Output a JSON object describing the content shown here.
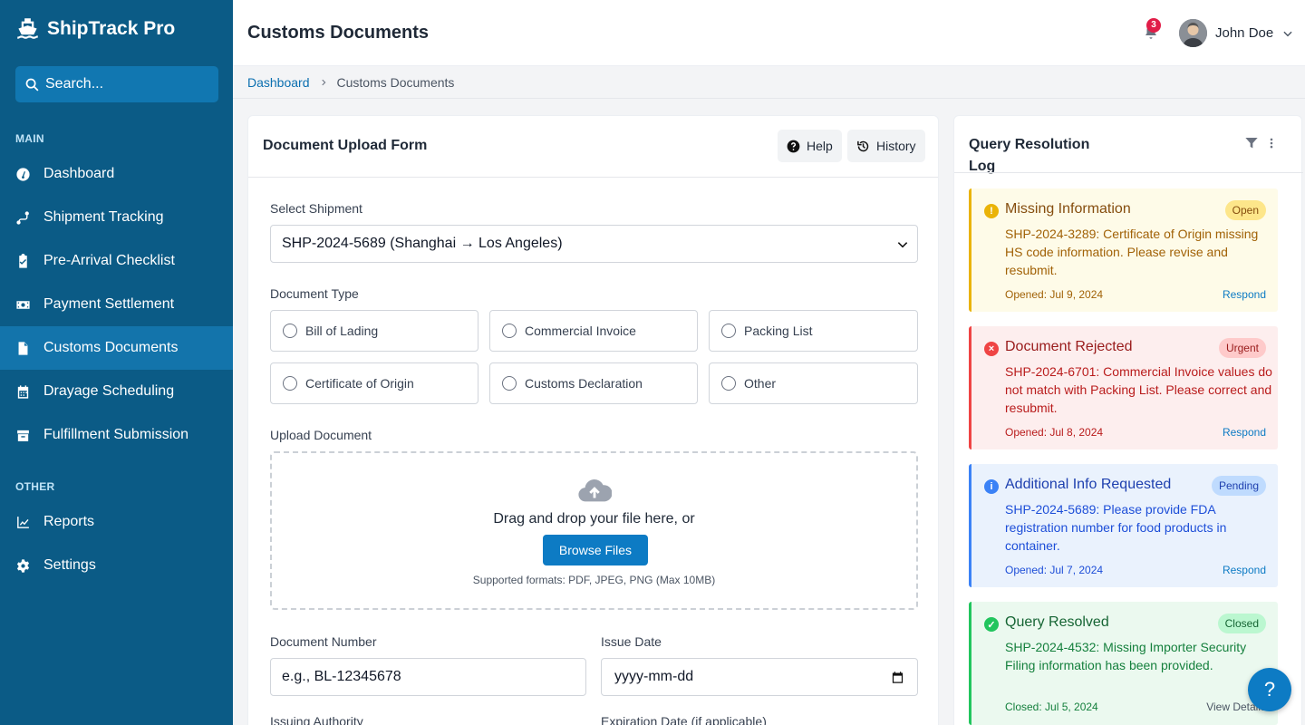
{
  "app": {
    "name": "ShipTrack Pro"
  },
  "search": {
    "placeholder": "Search..."
  },
  "sidebar": {
    "main_label": "MAIN",
    "other_label": "OTHER",
    "items": [
      {
        "label": "Dashboard",
        "icon": "gauge-icon"
      },
      {
        "label": "Shipment Tracking",
        "icon": "route-icon"
      },
      {
        "label": "Pre-Arrival Checklist",
        "icon": "clipboard-check-icon"
      },
      {
        "label": "Payment Settlement",
        "icon": "money-icon"
      },
      {
        "label": "Customs Documents",
        "icon": "file-icon",
        "active": true
      },
      {
        "label": "Drayage Scheduling",
        "icon": "calendar-icon"
      },
      {
        "label": "Fulfillment Submission",
        "icon": "box-icon"
      }
    ],
    "other_items": [
      {
        "label": "Reports",
        "icon": "chart-line-icon"
      },
      {
        "label": "Settings",
        "icon": "gear-icon"
      }
    ]
  },
  "header": {
    "title": "Customs Documents",
    "notifications": "3",
    "user_name": "John Doe"
  },
  "breadcrumb": {
    "home": "Dashboard",
    "current": "Customs Documents"
  },
  "form": {
    "title": "Document Upload Form",
    "help_label": "Help",
    "history_label": "History",
    "shipment_label": "Select Shipment",
    "shipment_value": "SHP-2024-5689 (Shanghai → Los Angeles)",
    "doc_type_label": "Document Type",
    "doc_types": [
      "Bill of Lading",
      "Commercial Invoice",
      "Packing List",
      "Certificate of Origin",
      "Customs Declaration",
      "Other"
    ],
    "upload_label": "Upload Document",
    "drop_text": "Drag and drop your file here, or",
    "browse_label": "Browse Files",
    "formats_text": "Supported formats: PDF, JPEG, PNG (Max 10MB)",
    "doc_number_label": "Document Number",
    "doc_number_placeholder": "e.g., BL-12345678",
    "issue_date_label": "Issue Date",
    "issue_date_placeholder": "yyyy-mm-dd",
    "issuing_authority_label": "Issuing Authority",
    "expiration_label": "Expiration Date (if applicable)"
  },
  "query_log": {
    "title": "Query Resolution Log",
    "items": [
      {
        "title": "Missing Information",
        "badge": "Open",
        "text": "SHP-2024-3289: Certificate of Origin missing HS code information. Please revise and resubmit.",
        "date": "Opened: Jul 9, 2024",
        "action": "Respond"
      },
      {
        "title": "Document Rejected",
        "badge": "Urgent",
        "text": "SHP-2024-6701: Commercial Invoice values do not match with Packing List. Please correct and resubmit.",
        "date": "Opened: Jul 8, 2024",
        "action": "Respond"
      },
      {
        "title": "Additional Info Requested",
        "badge": "Pending",
        "text": "SHP-2024-5689: Please provide FDA registration number for food products in container.",
        "date": "Opened: Jul 7, 2024",
        "action": "Respond"
      },
      {
        "title": "Query Resolved",
        "badge": "Closed",
        "text": "SHP-2024-4532: Missing Importer Security Filing information has been provided.",
        "date": "Closed: Jul 5, 2024",
        "action": "View Details"
      }
    ]
  },
  "fab": {
    "label": "?"
  },
  "colors": {
    "sidebar": "#0b5b86",
    "active": "#1374ab",
    "accent": "#0d7bc4"
  }
}
